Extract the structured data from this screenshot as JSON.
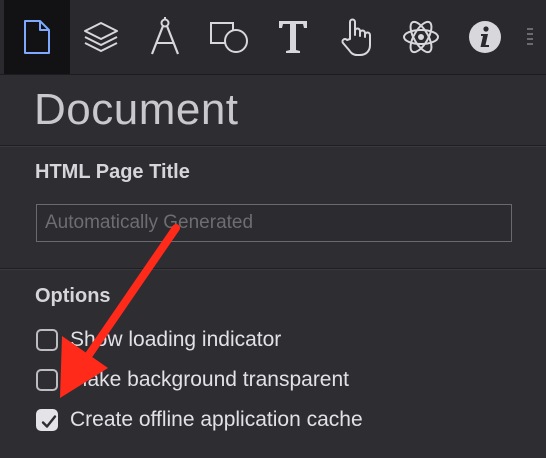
{
  "toolbar": {
    "tools": [
      {
        "name": "document-icon",
        "active": true
      },
      {
        "name": "layers-icon",
        "active": false
      },
      {
        "name": "compass-icon",
        "active": false
      },
      {
        "name": "shapes-icon",
        "active": false
      },
      {
        "name": "text-icon",
        "glyph": "T",
        "active": false
      },
      {
        "name": "hand-pointer-icon",
        "active": false
      },
      {
        "name": "atom-icon",
        "active": false
      },
      {
        "name": "info-icon",
        "glyph": "i",
        "active": false
      }
    ]
  },
  "panel": {
    "title": "Document",
    "page_title_section": {
      "label": "HTML Page Title",
      "input_value": "",
      "input_placeholder": "Automatically Generated"
    },
    "options_section": {
      "label": "Options",
      "items": [
        {
          "label": "Show loading indicator",
          "checked": false
        },
        {
          "label": "Make background transparent",
          "checked": false
        },
        {
          "label": "Create offline application cache",
          "checked": true
        }
      ]
    }
  },
  "colors": {
    "background": "#2e2d32",
    "active_tool_bg": "#121214",
    "icon_active": "#7fa8ff",
    "icon_default": "#d8d7db",
    "annotation_arrow": "#ff2a1a"
  }
}
